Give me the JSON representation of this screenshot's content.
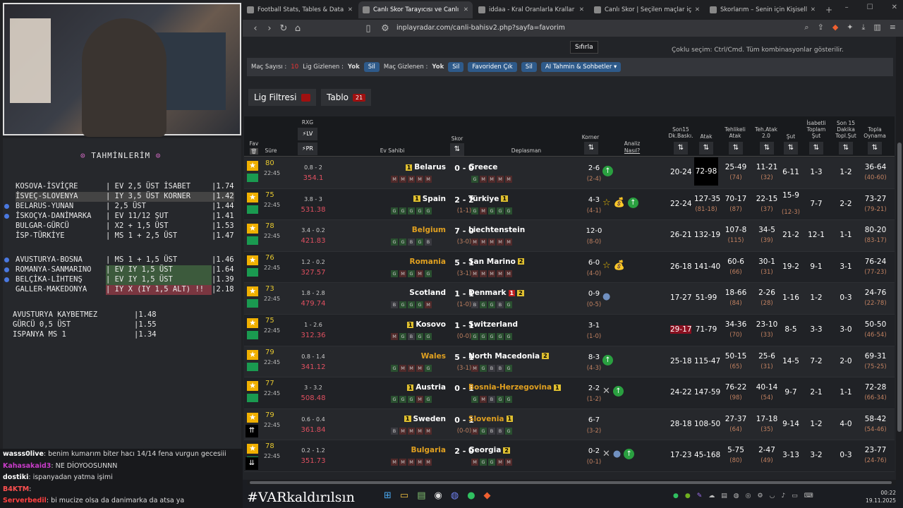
{
  "predictions": {
    "title": "TAHMİNLERİM",
    "rows": [
      {
        "match": "KOSOVA-İSVİÇRE",
        "bet": "EV 2,5 ÜST İSABET",
        "odd": "1.74",
        "dot": false,
        "style": ""
      },
      {
        "match": "İSVEÇ-SLOVENYA",
        "bet": "IY 3,5 ÜST KORNER",
        "odd": "1.42",
        "dot": false,
        "style": "sel"
      },
      {
        "match": "BELARUS-YUNAN",
        "bet": "2,5 ÜST",
        "odd": "1.44",
        "dot": true,
        "style": ""
      },
      {
        "match": "İSKOÇYA-DANİMARKA",
        "bet": "EV 11/12 ŞUT",
        "odd": "1.41",
        "dot": true,
        "style": ""
      },
      {
        "match": "BULGAR-GÜRCÜ",
        "bet": "X2 + 1,5 ÜST",
        "odd": "1.53",
        "dot": false,
        "style": ""
      },
      {
        "match": "İSP-TÜRKİYE",
        "bet": "MS 1 + 2,5 ÜST",
        "odd": "1.47",
        "dot": false,
        "style": ""
      },
      {
        "match": "AVUSTURYA-BOSNA",
        "bet": "MS 1 + 1,5 ÜST",
        "odd": "1.46",
        "dot": true,
        "style": ""
      },
      {
        "match": "ROMANYA-SANMARINO",
        "bet": "EV IY 1,5 ÜST",
        "odd": "1.64",
        "dot": true,
        "style": "hl"
      },
      {
        "match": "BELÇİKA-LİHTENŞ",
        "bet": "EV IY 1,5 ÜST",
        "odd": "1.39",
        "dot": true,
        "style": "hl"
      },
      {
        "match": "GALLER-MAKEDONYA",
        "bet": "IY X (IY 1,5 ALT) !!",
        "odd": "2.18",
        "dot": false,
        "style": "red"
      }
    ],
    "second": [
      {
        "bet": "AVUSTURYA KAYBETMEZ",
        "odd": "1.48"
      },
      {
        "bet": "GÜRCÜ 0,5 ÜST",
        "odd": "1.55"
      },
      {
        "bet": "ISPANYA MS 1",
        "odd": "1.34"
      }
    ]
  },
  "chat": [
    {
      "user": "wasss0live",
      "color": "#ffffff",
      "msg": ": benim kumarım biter hacı 14/14 fena vurgun gecesiii"
    },
    {
      "user": "Kahasakaid3",
      "color": "#c83cc8",
      "msg": ": NE DİOYOOSUNNN"
    },
    {
      "user": "dostiki",
      "color": "#ffffff",
      "msg": ": ispanyadan yatma işimi"
    },
    {
      "user": "B4KTM",
      "color": "#ff5050",
      "msg": ": "
    },
    {
      "user": "Serverbedil",
      "color": "#ff4040",
      "msg": ": bi mucize olsa da danimarka da atsa ya"
    }
  ],
  "ticker": "#VARkaldırılsın",
  "browser": {
    "tabs": [
      {
        "label": "Football Stats, Tables & Data | Socc",
        "active": false
      },
      {
        "label": "Canlı Skor Tarayıcısı ve Canlı Sk",
        "active": true
      },
      {
        "label": "iddaa - Kral Oranlarla Krallar Gibi K",
        "active": false
      },
      {
        "label": "Canlı Skor | Seçilen maçlar için canl",
        "active": false
      },
      {
        "label": "Skorlarım – Senin için Kişiselleştirilm",
        "active": false
      }
    ],
    "url": "inplayradar.com/canli-bahisv2.php?sayfa=favorim"
  },
  "page": {
    "reset": "Sıfırla",
    "multi_note": "Çoklu seçim: Ctrl/Cmd. Tüm kombinasyonlar gösterilir.",
    "filter": {
      "count_label": "Maç Sayısı :",
      "count": "10",
      "lig_label": "Lig Gizlenen :",
      "lig_val": "Yok",
      "sil": "Sil",
      "mac_label": "Maç Gizlenen :",
      "mac_val": "Yok",
      "fav_out": "Favoriden Çık",
      "ai": "AI Tahmin & Sohbetler"
    },
    "lig_filtre": "Lig Filtresi",
    "tablo": "Tablo",
    "tablo_count": "21",
    "headers": {
      "rxg": "RXG",
      "lv": "LV",
      "pr": "PR",
      "fav": "Fav",
      "sure": "Süre",
      "ev": "Ev Sahibi",
      "skor": "Skor",
      "dep": "Deplasman",
      "korner": "Korner",
      "analiz": "Analiz",
      "nasil": "Nasıl?",
      "son15": "Son15 Dk.Baskı.",
      "atak": "Atak",
      "tehlikeli": "Tehlikeli Atak",
      "teh2": "Teh.Atak 2.0",
      "sut": "Şut",
      "isabet": "İsabetli Toplam Şut",
      "son15sut": "Son 15 Dakika Topl.Şut",
      "topla": "Topla Oynama"
    }
  },
  "matches": [
    {
      "min": "80",
      "time": "22:45",
      "rxg1": "0.8 - 2",
      "rxg2": "354.1",
      "home": "Belarus",
      "hgold": false,
      "hy": "1",
      "score": "0 - 0",
      "ht": "",
      "away": "Greece",
      "agold": false,
      "ay": "",
      "ar": "",
      "hform": [
        "M",
        "M",
        "M",
        "M",
        "M"
      ],
      "aform": [
        "G",
        "M",
        "M",
        "M",
        "M"
      ],
      "kor": "2-6",
      "kor2": "(2-4)",
      "anz": [
        "up"
      ],
      "son15": "20-24",
      "atak": "72-98",
      "atak_hl": true,
      "son_red": false,
      "teh1": "25-49",
      "teh2": "(74)",
      "th1": "11-21",
      "th2": "(32)",
      "sut": "6-11",
      "sut2": "",
      "isb": "1-3",
      "s15": "1-2",
      "top1": "36-64",
      "top2": "(40-60)"
    },
    {
      "min": "75",
      "time": "22:45",
      "rxg1": "3.8 - 3",
      "rxg2": "531.38",
      "home": "Spain",
      "hgold": false,
      "hy": "1",
      "score": "2 - 2",
      "ht": "(1-1)",
      "away": "Türkiye",
      "agold": false,
      "ay": "1",
      "ar": "",
      "hform": [
        "G",
        "G",
        "G",
        "G",
        "G"
      ],
      "aform": [
        "G",
        "M",
        "G",
        "G",
        "G"
      ],
      "kor": "4-3",
      "kor2": "(4-1)",
      "anz": [
        "star",
        "bag",
        "up"
      ],
      "son15": "22-24",
      "atak": "127-35",
      "atak2": "(81-18)",
      "atak_hl": false,
      "son_red": false,
      "teh1": "70-17",
      "teh2": "(87)",
      "th1": "22-15",
      "th2": "(37)",
      "sut": "15-9",
      "sut2": "(12-3)",
      "isb": "7-7",
      "s15": "2-2",
      "top1": "73-27",
      "top2": "(79-21)"
    },
    {
      "min": "78",
      "time": "22:45",
      "rxg1": "3.4 - 0.2",
      "rxg2": "421.83",
      "home": "Belgium",
      "hgold": true,
      "hy": "",
      "score": "7 - 0",
      "ht": "(3-0)",
      "away": "Liechtenstein",
      "agold": false,
      "ay": "",
      "ar": "",
      "hform": [
        "G",
        "G",
        "B",
        "G",
        "B"
      ],
      "aform": [
        "M",
        "M",
        "M",
        "M",
        "M"
      ],
      "kor": "12-0",
      "kor2": "(8-0)",
      "anz": [],
      "son15": "26-21",
      "atak": "132-19",
      "atak_hl": false,
      "son_red": false,
      "teh1": "107-8",
      "teh2": "(115)",
      "th1": "34-5",
      "th2": "(39)",
      "sut": "21-2",
      "sut2": "",
      "isb": "12-1",
      "s15": "1-1",
      "top1": "80-20",
      "top2": "(83-17)"
    },
    {
      "min": "76",
      "time": "22:45",
      "rxg1": "1.2 - 0.2",
      "rxg2": "327.57",
      "home": "Romania",
      "hgold": true,
      "hy": "",
      "score": "5 - 1",
      "ht": "(3-1)",
      "away": "San Marino",
      "agold": false,
      "ay": "2",
      "ar": "",
      "hform": [
        "G",
        "M",
        "G",
        "M",
        "G"
      ],
      "aform": [
        "M",
        "M",
        "M",
        "M",
        "M"
      ],
      "kor": "6-0",
      "kor2": "(4-0)",
      "anz": [
        "star",
        "bag"
      ],
      "son15": "26-18",
      "atak": "141-40",
      "atak_hl": false,
      "son_red": false,
      "teh1": "60-6",
      "teh2": "(66)",
      "th1": "30-1",
      "th2": "(31)",
      "sut": "19-2",
      "sut2": "",
      "isb": "9-1",
      "s15": "3-1",
      "top1": "76-24",
      "top2": "(77-23)"
    },
    {
      "min": "73",
      "time": "22:45",
      "rxg1": "1.8 - 2.8",
      "rxg2": "479.74",
      "home": "Scotland",
      "hgold": false,
      "hy": "",
      "score": "1 - 1",
      "ht": "(1-0)",
      "away": "Denmark",
      "agold": false,
      "ay": "2",
      "ar": "1",
      "hform": [
        "B",
        "G",
        "G",
        "G",
        "M"
      ],
      "aform": [
        "B",
        "G",
        "G",
        "B",
        "G"
      ],
      "kor": "0-9",
      "kor2": "(0-5)",
      "anz": [
        "drop"
      ],
      "son15": "17-27",
      "atak": "51-99",
      "atak_hl": false,
      "son_red": false,
      "teh1": "18-66",
      "teh2": "(84)",
      "th1": "2-26",
      "th2": "(28)",
      "sut": "1-16",
      "sut2": "",
      "isb": "1-2",
      "s15": "0-3",
      "top1": "24-76",
      "top2": "(22-78)"
    },
    {
      "min": "75",
      "time": "22:45",
      "rxg1": "1 - 2.6",
      "rxg2": "312.36",
      "home": "Kosovo",
      "hgold": false,
      "hy": "1",
      "score": "1 - 1",
      "ht": "(0-0)",
      "away": "Switzerland",
      "agold": false,
      "ay": "",
      "ar": "",
      "hform": [
        "M",
        "G",
        "B",
        "G",
        "G"
      ],
      "aform": [
        "G",
        "G",
        "G",
        "G",
        "G"
      ],
      "kor": "3-1",
      "kor2": "(1-0)",
      "anz": [],
      "son15": "29-17",
      "atak": "71-79",
      "atak_hl": false,
      "son_red": true,
      "teh1": "34-36",
      "teh2": "(70)",
      "th1": "23-10",
      "th2": "(33)",
      "sut": "8-5",
      "sut2": "",
      "isb": "3-3",
      "s15": "3-0",
      "top1": "50-50",
      "top2": "(46-54)"
    },
    {
      "min": "79",
      "time": "22:45",
      "rxg1": "0.8 - 1.4",
      "rxg2": "341.12",
      "home": "Wales",
      "hgold": true,
      "hy": "",
      "score": "5 - 1",
      "ht": "(3-1)",
      "away": "North Macedonia",
      "agold": false,
      "ay": "2",
      "ar": "",
      "hform": [
        "G",
        "M",
        "M",
        "M",
        "G"
      ],
      "aform": [
        "M",
        "G",
        "B",
        "B",
        "G"
      ],
      "kor": "8-3",
      "kor2": "(4-3)",
      "anz": [
        "up"
      ],
      "son15": "25-18",
      "atak": "115-47",
      "atak_hl": false,
      "son_red": false,
      "teh1": "50-15",
      "teh2": "(65)",
      "th1": "25-6",
      "th2": "(31)",
      "sut": "14-5",
      "sut2": "",
      "isb": "7-2",
      "s15": "2-0",
      "top1": "69-31",
      "top2": "(75-25)"
    },
    {
      "min": "77",
      "time": "22:45",
      "rxg1": "3 - 3.2",
      "rxg2": "508.48",
      "home": "Austria",
      "hgold": false,
      "hy": "1",
      "score": "0 - 1",
      "ht": "",
      "away": "Bosnia-Herzegovina",
      "agold": true,
      "ay": "1",
      "ar": "",
      "hform": [
        "G",
        "G",
        "G",
        "M",
        "G"
      ],
      "aform": [
        "G",
        "M",
        "B",
        "G",
        "G"
      ],
      "kor": "2-2",
      "kor2": "(1-2)",
      "anz": [
        "x",
        "up"
      ],
      "son15": "24-22",
      "atak": "147-59",
      "atak_hl": false,
      "son_red": false,
      "teh1": "76-22",
      "teh2": "(98)",
      "th1": "40-14",
      "th2": "(54)",
      "sut": "9-7",
      "sut2": "",
      "isb": "2-1",
      "s15": "1-1",
      "top1": "72-28",
      "top2": "(66-34)"
    },
    {
      "min": "79",
      "time": "22:45",
      "rxg1": "0.6 - 0.4",
      "rxg2": "361.84",
      "home": "Sweden",
      "hgold": false,
      "hy": "1",
      "score": "0 - 1",
      "ht": "(0-0)",
      "away": "Slovenia",
      "agold": true,
      "ay": "1",
      "ar": "",
      "hform": [
        "B",
        "M",
        "M",
        "M",
        "M"
      ],
      "aform": [
        "M",
        "G",
        "B",
        "B",
        "G"
      ],
      "kor": "6-7",
      "kor2": "(3-2)",
      "anz": [],
      "son15": "28-18",
      "atak": "108-50",
      "atak_hl": false,
      "son_red": false,
      "teh1": "27-37",
      "teh2": "(64)",
      "th1": "17-18",
      "th2": "(35)",
      "sut": "9-14",
      "sut2": "",
      "isb": "1-2",
      "s15": "4-0",
      "top1": "58-42",
      "top2": "(54-46)"
    },
    {
      "min": "78",
      "time": "22:45",
      "rxg1": "0.2 - 1.2",
      "rxg2": "351.73",
      "home": "Bulgaria",
      "hgold": true,
      "hy": "",
      "score": "2 - 0",
      "ht": "",
      "away": "Georgia",
      "agold": false,
      "ay": "2",
      "ar": "",
      "hform": [
        "M",
        "M",
        "M",
        "M",
        "M"
      ],
      "aform": [
        "M",
        "G",
        "G",
        "M",
        "M"
      ],
      "kor": "0-2",
      "kor2": "(0-1)",
      "anz": [
        "x",
        "drop",
        "up"
      ],
      "son15": "17-23",
      "atak": "45-168",
      "atak_hl": false,
      "son_red": false,
      "teh1": "5-75",
      "teh2": "(80)",
      "th1": "2-47",
      "th2": "(49)",
      "sut": "3-13",
      "sut2": "",
      "isb": "3-2",
      "s15": "0-3",
      "top1": "23-77",
      "top2": "(24-76)"
    }
  ],
  "taskbar": {
    "time": "00:22",
    "date": "19.11.2025"
  }
}
